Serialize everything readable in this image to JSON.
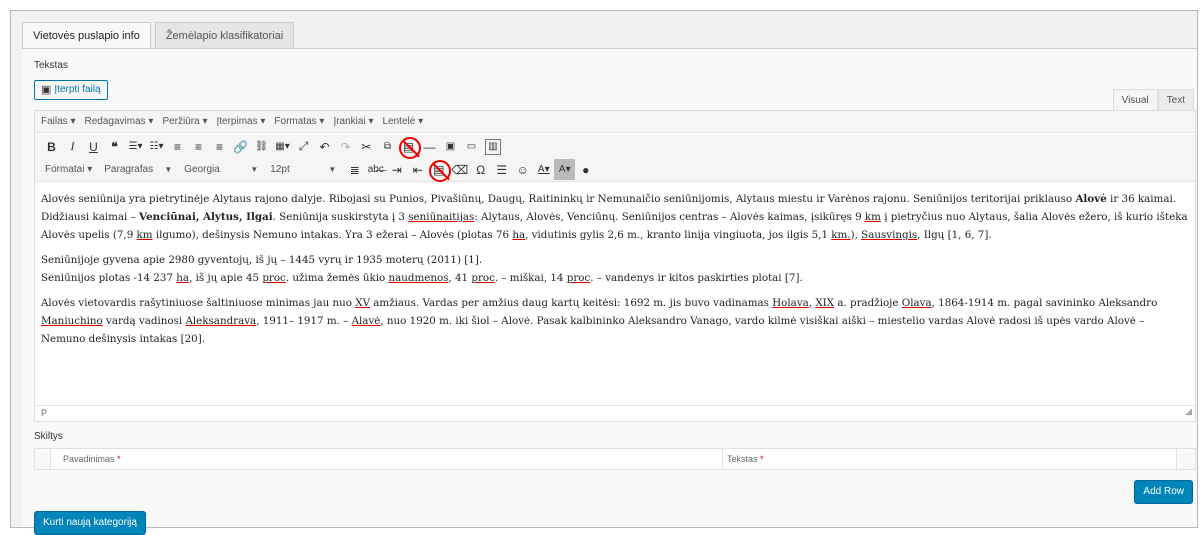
{
  "tabs": [
    {
      "label": "Vietovės puslapio info",
      "active": true
    },
    {
      "label": "Žemėlapio klasifikatoriai",
      "active": false
    }
  ],
  "field_label": "Tekstas",
  "add_media_label": "Įterpti failą",
  "mode_tabs": {
    "visual": "Visual",
    "text": "Text"
  },
  "menubar": [
    "Failas ▾",
    "Redagavimas ▾",
    "Peržiūra ▾",
    "Įterpimas ▾",
    "Formatas ▾",
    "Įrankiai ▾",
    "Lentelė ▾"
  ],
  "toolbar1_icons": [
    "bold-icon",
    "italic-icon",
    "underline-icon",
    "blockquote-icon",
    "bullet-list-icon",
    "numbered-list-icon",
    "align-left-icon",
    "align-center-icon",
    "align-right-icon",
    "link-icon",
    "unlink-icon",
    "table-icon",
    "fullscreen-icon",
    "undo-icon",
    "redo-icon",
    "cut-icon",
    "copy-icon",
    "paste-icon",
    "horizontal-line-icon",
    "image-icon",
    "media-icon",
    "kitchen-sink-icon"
  ],
  "toolbar2": {
    "formats": "Formatai ▾",
    "paragraph": "Paragrafas",
    "font": "Georgia",
    "size": "12pt"
  },
  "bold_glyphs": {
    "bold": "B",
    "italic": "I",
    "underline": "U",
    "quote": "❝",
    "omega": "Ω",
    "help": "?"
  },
  "content": {
    "p1_a": "Alovės seniūnija yra pietrytinėje Alytaus rajono dalyje. Ribojasi su Punios, Pivašiūnų, Daugų, Raitininkų ir Nemunaičio seniūnijomis, Alytaus miestu ir Varėnos rajonu. Seniūnijos teritorijai priklauso ",
    "p1_b": "Alovė",
    "p1_c": " ir 36 kaimai. Didžiausi kaimai – ",
    "p1_d": "Venciūnai, Alytus, Ilgai",
    "p1_e": ". Seniūnija suskirstyta į 3 ",
    "p1_f": "seniūnaitijas",
    "p1_g": ": Alytaus, Alovės, Venciūnų. Seniūnijos centras – Alovės kaimas, įsikūręs 9 ",
    "p1_h": "km",
    "p1_i": " į pietryčius nuo Alytaus, šalia Alovės ežero, iš kurio išteka Alovės upelis (7,9 ",
    "p1_j": "km",
    "p1_k": " ilgumo), dešinysis Nemuno intakas. Yra 3 ežerai – Alovės (plotas 76 ",
    "p1_l": "ha",
    "p1_m": ", vidutinis gylis 2,6 m., kranto linija vingiuota, jos ilgis 5,1 ",
    "p1_n": "km.",
    "p1_o": "), ",
    "p1_p": "Sausvingis",
    "p1_q": ", Ilgų [1, 6, 7].",
    "p2_a": "Seniūnijoje gyvena apie 2980 gyventojų, iš jų – 1445 vyrų ir 1935 moterų (2011) [1].",
    "p2_b": "Seniūnijos plotas -14 237 ",
    "p2_c": "ha",
    "p2_d": ", iš jų apie 45 ",
    "p2_e": "proc",
    "p2_f": ". užima žemės ūkio ",
    "p2_g": "naudmenos",
    "p2_h": ", 41 ",
    "p2_i": "proc",
    "p2_j": ". – miškai, 14 ",
    "p2_k": "proc",
    "p2_l": ". – vandenys ir kitos paskirties plotai [7].",
    "p3_a": "Alovės vietovardis rašytiniuose šaltiniuose minimas jau nuo ",
    "p3_b": "XV",
    "p3_c": " amžiaus. Vardas per amžius daug kartų keitėsi: 1692 m. jis buvo vadinamas ",
    "p3_d": "Holava",
    "p3_e": ", ",
    "p3_f": "XIX",
    "p3_g": " a. pradžioje ",
    "p3_h": "Olava",
    "p3_i": ", 1864-1914 m. pagal savininko Aleksandro ",
    "p3_j": "Maniuchino",
    "p3_k": " vardą vadinosi ",
    "p3_l": "Aleksandrava",
    "p3_m": ", 1911– 1917 m. – ",
    "p3_n": "Alavė",
    "p3_o": ", nuo 1920 m. iki šiol – Alovė. Pasak kalbininko Aleksandro Vanago, vardo kilmė visiškai aiški – miestelio vardas Alovė radosi iš upės vardo Alovė – Nemuno dešinysis intakas [20]."
  },
  "status_path": "P",
  "columns_label": "Skiltys",
  "table": {
    "col1": "Pavadinimas",
    "col2": "Tekstas",
    "required_mark": "*"
  },
  "add_row_label": "Add Row",
  "new_category_label": "Kurti naują kategoriją",
  "colors": {
    "primary": "#0085ba",
    "ban": "#e00000",
    "spell_underline": "#dd0000"
  }
}
